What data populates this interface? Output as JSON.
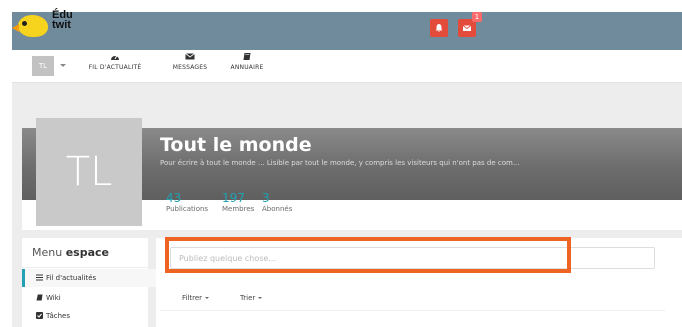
{
  "brand": {
    "line1": "Édu",
    "line2": "twit",
    "color": "#f6d31c"
  },
  "topbar": {
    "color": "#6f8b9c",
    "bell_icon": "bell-icon",
    "mail_icon": "envelope-icon",
    "mail_badge": "1"
  },
  "nav": {
    "avatar_initials": "TL",
    "items": [
      {
        "label": "FIL D'ACTUALITÉ",
        "icon": "dashboard-icon"
      },
      {
        "label": "MESSAGES",
        "icon": "envelope-icon"
      },
      {
        "label": "ANNUAIRE",
        "icon": "book-icon"
      }
    ]
  },
  "space": {
    "avatar_initials": "TL",
    "title": "Tout le monde",
    "description": "Pour écrire à tout le monde ... Lisible par tout le monde, y compris les visiteurs qui n'ont pas de com...",
    "stats": [
      {
        "value": "43",
        "label": "Publications"
      },
      {
        "value": "197",
        "label": "Membres"
      },
      {
        "value": "3",
        "label": "Abonnés"
      }
    ],
    "accent": "#21a1b3"
  },
  "sidebar": {
    "title_prefix": "Menu",
    "title_bold": "espace",
    "items": [
      {
        "label": "Fil d'actualités",
        "icon": "list-icon"
      },
      {
        "label": "Wiki",
        "icon": "book-icon"
      },
      {
        "label": "Tâches",
        "icon": "checkbox-icon"
      }
    ]
  },
  "stream": {
    "post_placeholder": "Publiez quelque chose...",
    "filter_label": "Filtrer",
    "sort_label": "Trier",
    "highlight_color": "#ef6422"
  }
}
